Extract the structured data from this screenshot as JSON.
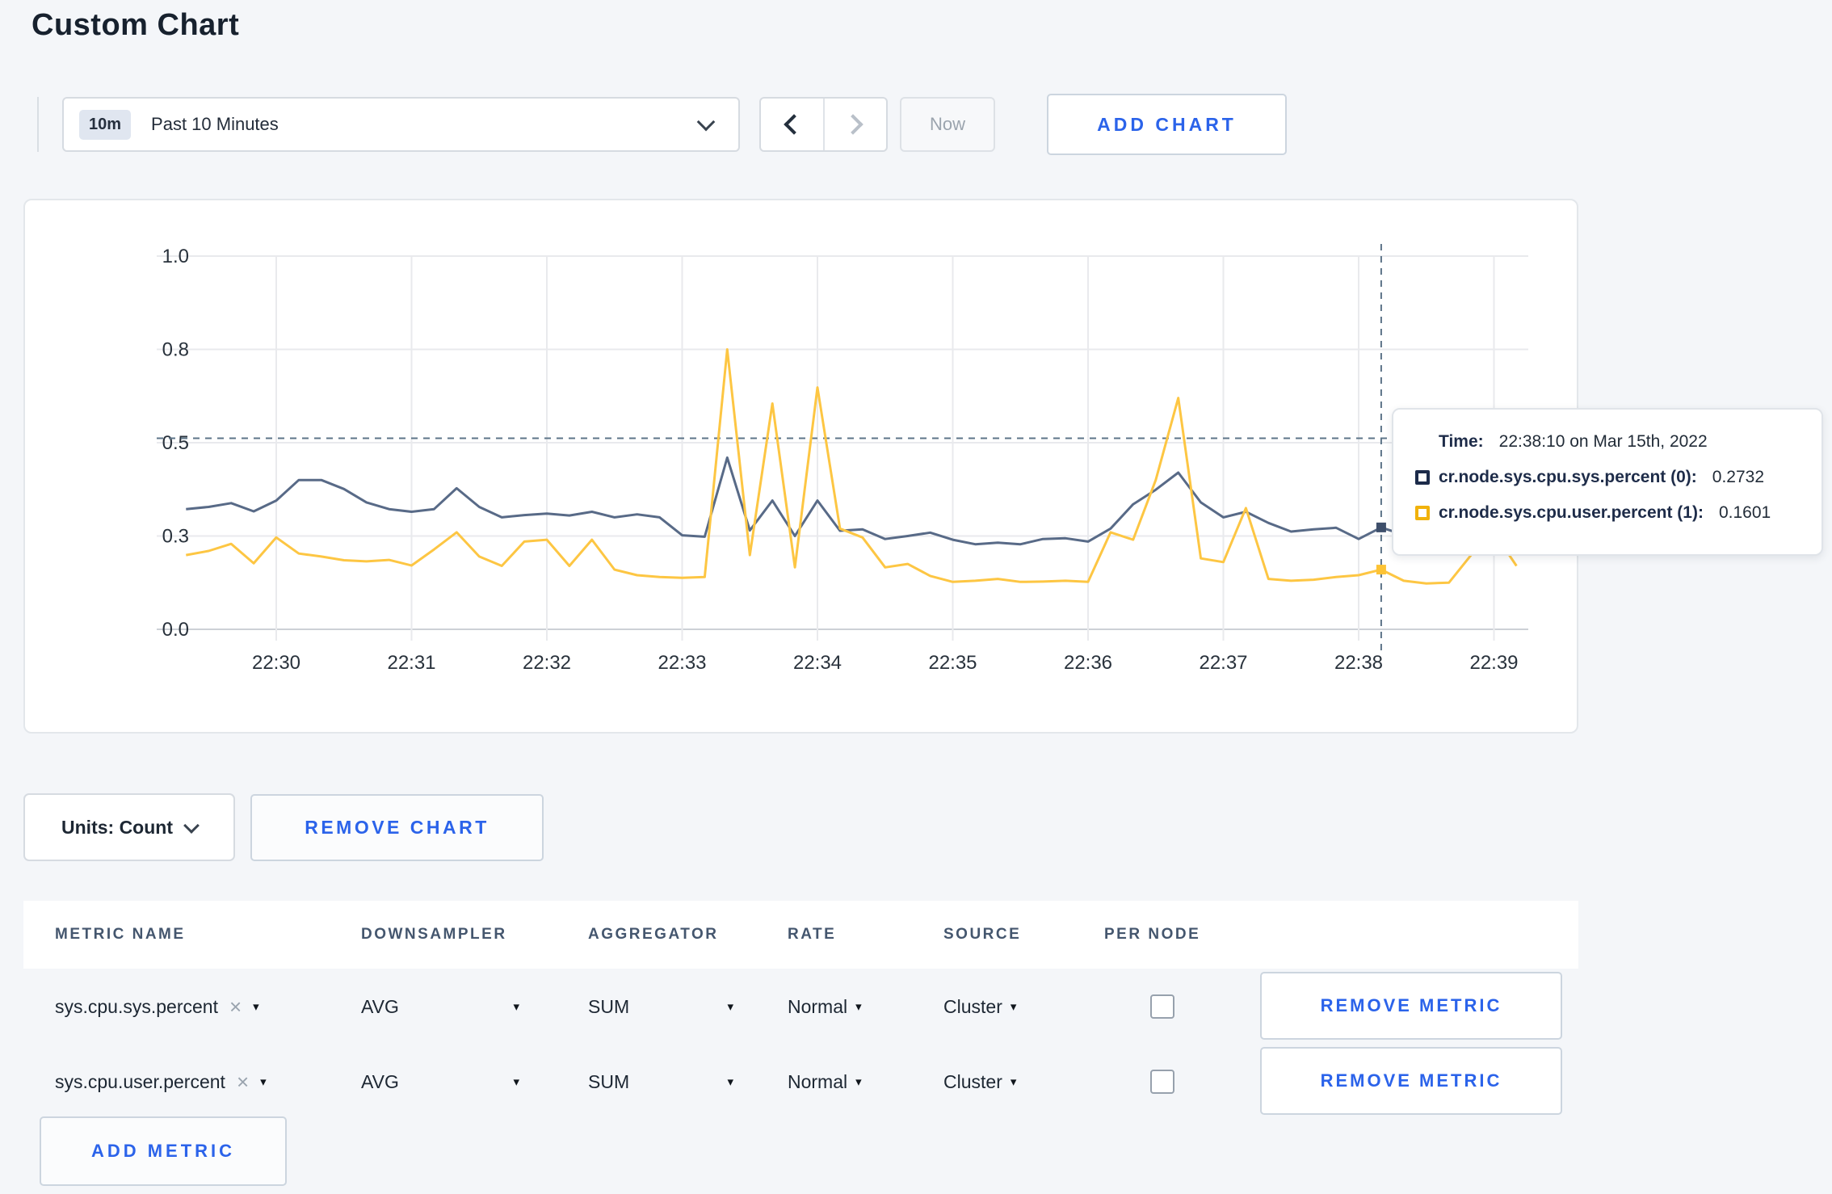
{
  "header": {
    "title": "Custom Chart"
  },
  "toolbar": {
    "time_window_badge": "10m",
    "time_window_label": "Past 10 Minutes",
    "now_label": "Now",
    "add_chart_label": "ADD CHART"
  },
  "colors": {
    "accent_blue": "#2b63ea",
    "series_sys": "#586a87",
    "series_user": "#fdc643",
    "swatch_sys": "#1c2b4a",
    "swatch_user": "#f1b20b",
    "crosshair": "#5d7488"
  },
  "chart_data": {
    "type": "line",
    "title": "",
    "xlabel": "",
    "ylabel": "",
    "ylim": [
      0,
      1
    ],
    "grid": true,
    "x_tick_labels": [
      "22:30",
      "22:31",
      "22:32",
      "22:33",
      "22:34",
      "22:35",
      "22:36",
      "22:37",
      "22:38",
      "22:39"
    ],
    "y_tick_values": [
      0,
      0.25,
      0.5,
      0.75,
      1.0
    ],
    "y_tick_labels": [
      "0.0",
      "0.3",
      "0.5",
      "0.8",
      "1.0"
    ],
    "x_start_time": "22:29:20",
    "x_step_seconds": 10,
    "series": [
      {
        "name": "cr.node.sys.cpu.sys.percent",
        "color": "#586a87",
        "values": [
          0.322,
          0.328,
          0.338,
          0.316,
          0.345,
          0.4,
          0.4,
          0.376,
          0.34,
          0.322,
          0.315,
          0.322,
          0.378,
          0.328,
          0.3,
          0.306,
          0.31,
          0.305,
          0.315,
          0.3,
          0.308,
          0.3,
          0.252,
          0.248,
          0.46,
          0.265,
          0.345,
          0.25,
          0.345,
          0.264,
          0.268,
          0.242,
          0.25,
          0.259,
          0.24,
          0.228,
          0.232,
          0.228,
          0.242,
          0.244,
          0.235,
          0.27,
          0.335,
          0.374,
          0.42,
          0.34,
          0.3,
          0.315,
          0.285,
          0.262,
          0.268,
          0.272,
          0.242,
          0.273,
          0.253,
          0.26,
          0.255,
          0.26,
          0.25,
          0.255
        ]
      },
      {
        "name": "cr.node.sys.cpu.user.percent",
        "color": "#fdc643",
        "values": [
          0.199,
          0.21,
          0.229,
          0.177,
          0.246,
          0.203,
          0.195,
          0.185,
          0.182,
          0.186,
          0.171,
          0.214,
          0.26,
          0.195,
          0.17,
          0.235,
          0.24,
          0.17,
          0.24,
          0.16,
          0.145,
          0.14,
          0.138,
          0.14,
          0.75,
          0.199,
          0.605,
          0.166,
          0.648,
          0.27,
          0.246,
          0.166,
          0.175,
          0.143,
          0.127,
          0.13,
          0.135,
          0.127,
          0.128,
          0.13,
          0.127,
          0.26,
          0.24,
          0.4,
          0.62,
          0.19,
          0.18,
          0.325,
          0.135,
          0.13,
          0.133,
          0.14,
          0.145,
          0.16,
          0.13,
          0.123,
          0.125,
          0.2,
          0.26,
          0.17
        ]
      }
    ],
    "crosshair": {
      "index": 53,
      "time": "22:38:10",
      "mouse_value": 0.512
    },
    "legend_position": "tooltip"
  },
  "tooltip": {
    "time_label": "Time:",
    "time_value": "22:38:10 on Mar 15th, 2022",
    "rows": [
      {
        "label": "cr.node.sys.cpu.sys.percent (0):",
        "value": "0.2732",
        "swatch": "#1c2b4a"
      },
      {
        "label": "cr.node.sys.cpu.user.percent (1):",
        "value": "0.1601",
        "swatch": "#f1b20b"
      }
    ]
  },
  "chart_controls": {
    "units_label": "Units: Count",
    "remove_chart_label": "REMOVE CHART"
  },
  "metrics_table": {
    "headers": [
      "METRIC NAME",
      "DOWNSAMPLER",
      "AGGREGATOR",
      "RATE",
      "SOURCE",
      "PER NODE"
    ],
    "rows": [
      {
        "metric": "sys.cpu.sys.percent",
        "downsampler": "AVG",
        "aggregator": "SUM",
        "rate": "Normal",
        "source": "Cluster",
        "per_node_checked": false,
        "remove_label": "REMOVE METRIC"
      },
      {
        "metric": "sys.cpu.user.percent",
        "downsampler": "AVG",
        "aggregator": "SUM",
        "rate": "Normal",
        "source": "Cluster",
        "per_node_checked": false,
        "remove_label": "REMOVE METRIC"
      }
    ],
    "add_metric_label": "ADD METRIC"
  },
  "icons": {
    "remove_x": "×",
    "dropdown_arrow": "▾"
  }
}
